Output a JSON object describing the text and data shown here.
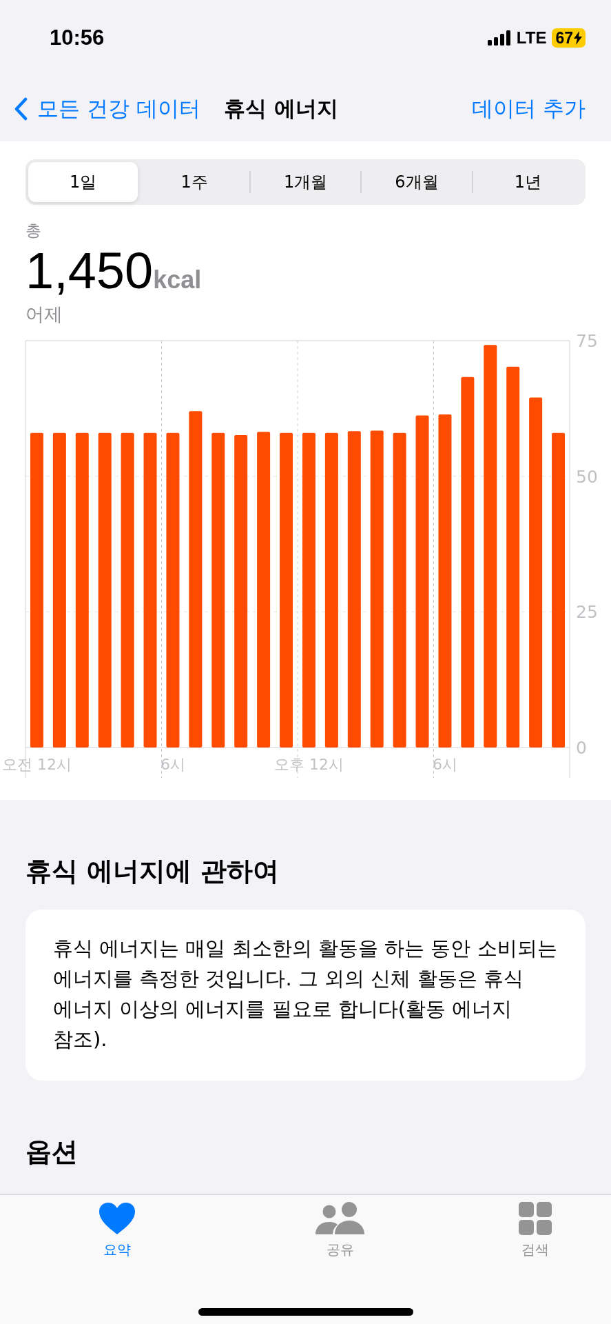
{
  "status_bar": {
    "time": "10:56",
    "network": "LTE",
    "battery": "67",
    "charging": true
  },
  "nav": {
    "back": "모든 건강 데이터",
    "title": "휴식 에너지",
    "action": "데이터 추가"
  },
  "ranges": [
    {
      "label": "1일",
      "selected": true
    },
    {
      "label": "1주",
      "selected": false
    },
    {
      "label": "1개월",
      "selected": false
    },
    {
      "label": "6개월",
      "selected": false
    },
    {
      "label": "1년",
      "selected": false
    }
  ],
  "summary": {
    "label": "총",
    "value": "1,450",
    "unit": "kcal",
    "date": "어제"
  },
  "chart": {
    "chart_data": {
      "type": "bar",
      "ylim": [
        0,
        75
      ],
      "yticks": [
        0,
        25,
        50,
        75
      ],
      "grid": true,
      "categories": [
        "오전 12시",
        null,
        null,
        null,
        null,
        null,
        "6시",
        null,
        null,
        null,
        null,
        null,
        "오후 12시",
        null,
        null,
        null,
        null,
        null,
        "6시",
        null,
        null,
        null,
        null,
        null
      ],
      "series": [
        {
          "color": "#ff4b00",
          "values": [
            58,
            58,
            58,
            58,
            58,
            58,
            58,
            62,
            58,
            57.6,
            58.2,
            58,
            58,
            58,
            58.3,
            58.4,
            58,
            61.2,
            61.4,
            68.3,
            74.2,
            70.2,
            64.5,
            58
          ]
        }
      ]
    }
  },
  "about": {
    "heading": "휴식 에너지에 관하여",
    "text": "휴식 에너지는 매일 최소한의 활동을 하는 동안 소비되는 에너지를 측정한 것입니다. 그 외의 신체 활동은 휴식 에너지 이상의 에너지를 필요로 합니다(활동 에너지 참조)."
  },
  "options": {
    "heading": "옵션"
  },
  "tab_bar": [
    {
      "label": "요약",
      "kind": "heart",
      "selected": true
    },
    {
      "label": "공유",
      "kind": "people",
      "selected": false
    },
    {
      "label": "검색",
      "kind": "grid",
      "selected": false
    }
  ]
}
